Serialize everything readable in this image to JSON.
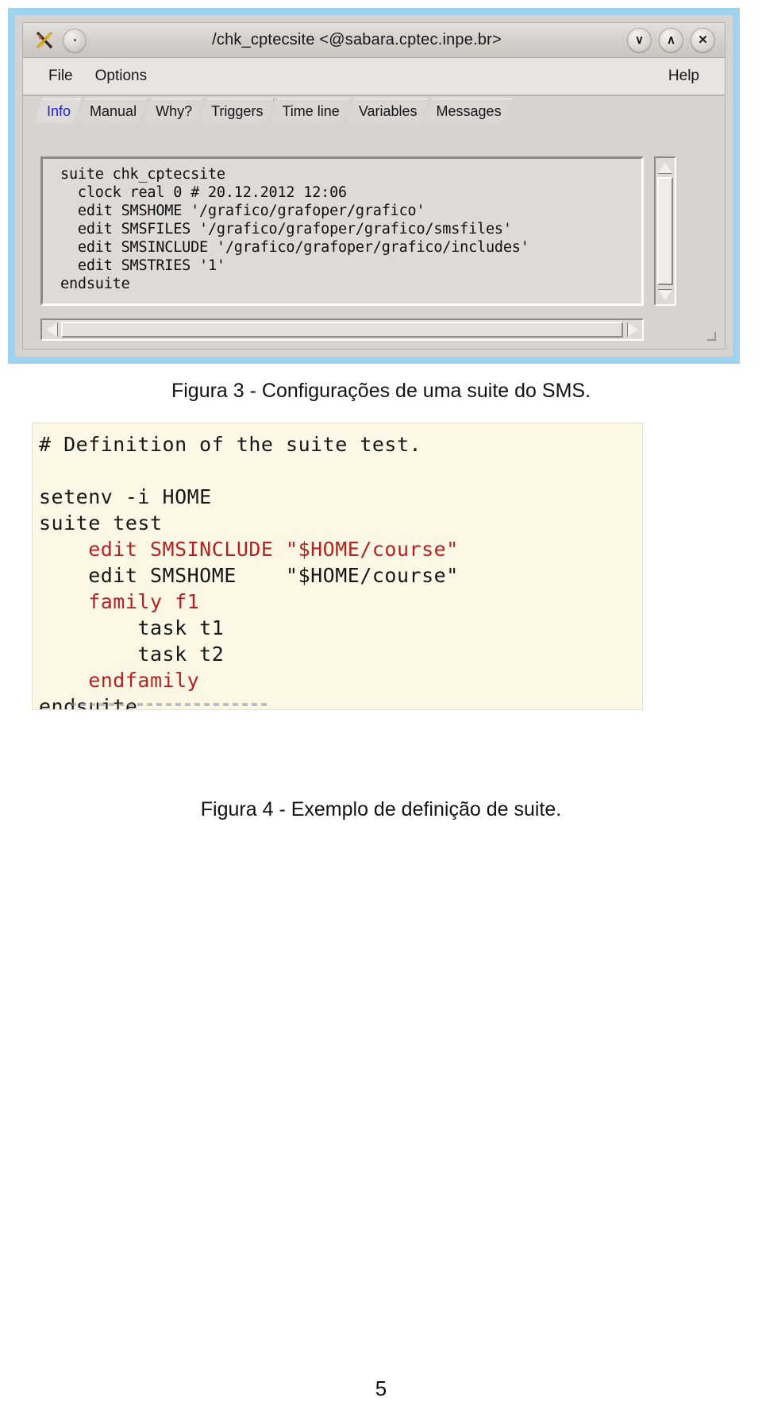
{
  "document": {
    "page_number": "5"
  },
  "figure3": {
    "caption": "Figura 3 - Configurações de uma suite do SMS.",
    "window": {
      "title": "/chk_cptecsite <@sabara.cptec.inpe.br>",
      "app_icon": "x-application-icon",
      "window_menu_button": "window-menu-button",
      "controls": {
        "minimize": "∨",
        "maximize": "∧",
        "close": "✕"
      },
      "menubar": {
        "file": "File",
        "options": "Options",
        "help": "Help"
      },
      "tabs": [
        {
          "label": "Info",
          "active": true
        },
        {
          "label": "Manual",
          "active": false
        },
        {
          "label": "Why?",
          "active": false
        },
        {
          "label": "Triggers",
          "active": false
        },
        {
          "label": "Time line",
          "active": false
        },
        {
          "label": "Variables",
          "active": false
        },
        {
          "label": "Messages",
          "active": false
        }
      ],
      "content": "suite chk_cptecsite\n  clock real 0 # 20.12.2012 12:06\n  edit SMSHOME '/grafico/grafoper/grafico'\n  edit SMSFILES '/grafico/grafoper/grafico/smsfiles'\n  edit SMSINCLUDE '/grafico/grafoper/grafico/includes'\n  edit SMSTRIES '1'\nendsuite",
      "scrollbars": {
        "vertical": "vertical-scrollbar",
        "horizontal": "horizontal-scrollbar"
      }
    },
    "colors": {
      "window_border": "#9ed2ee",
      "chrome": "#d6d3d0",
      "active_tab_text": "#2020c8"
    }
  },
  "figure4": {
    "caption": "Figura 4 - Exemplo de definição de suite.",
    "background": "#fdf8e6",
    "keyword_color": "#b32222",
    "lines": [
      {
        "text": "# Definition of the suite test.",
        "highlight": false
      },
      {
        "text": "",
        "highlight": false
      },
      {
        "text": "setenv -i HOME",
        "highlight": false
      },
      {
        "text": "suite test",
        "highlight": false
      },
      {
        "text": "    edit SMSINCLUDE \"$HOME/course\"",
        "highlight": true
      },
      {
        "text": "    edit SMSHOME    \"$HOME/course\"",
        "highlight": false
      },
      {
        "text": "    family f1",
        "highlight": true
      },
      {
        "text": "        task t1",
        "highlight": false
      },
      {
        "text": "        task t2",
        "highlight": false
      },
      {
        "text": "    endfamily",
        "highlight": true
      },
      {
        "text": "endsuite",
        "highlight": false
      }
    ]
  }
}
